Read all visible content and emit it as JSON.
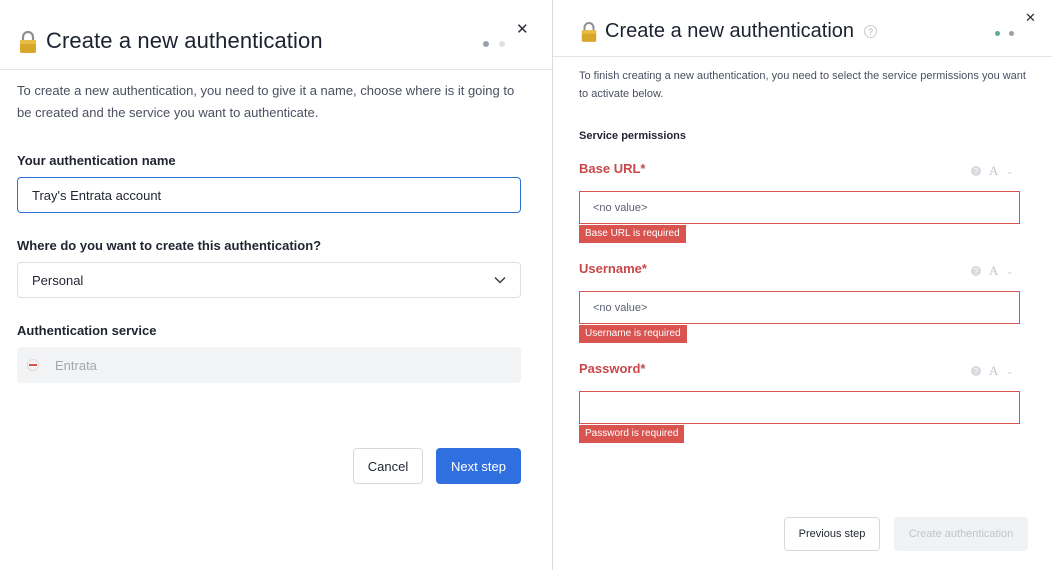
{
  "left": {
    "title": "Create a new authentication",
    "intro": "To create a new authentication, you need to give it a name, choose where is it going to be created and the service you want to authenticate.",
    "name_label": "Your authentication name",
    "name_value": "Tray's Entrata account",
    "location_label": "Where do you want to create this authentication?",
    "location_value": "Personal",
    "service_label": "Authentication service",
    "service_value": "Entrata",
    "cancel_label": "Cancel",
    "next_label": "Next step",
    "step_dots": {
      "active": "#9aa0aa",
      "inactive": "#dde0e5"
    }
  },
  "right": {
    "title": "Create a new authentication",
    "intro": "To finish creating a new authentication, you need to select the service permissions you want to activate below.",
    "permissions_heading": "Service permissions",
    "fields": [
      {
        "label": "Base URL*",
        "placeholder": "<no value>",
        "error": "Base URL is required"
      },
      {
        "label": "Username*",
        "placeholder": "<no value>",
        "error": "Username is required"
      },
      {
        "label": "Password*",
        "placeholder": "",
        "error": "Password is required"
      }
    ],
    "prev_label": "Previous step",
    "create_label": "Create authentication",
    "step_dots": {
      "done": "#5fae8a",
      "active": "#9aa0aa"
    }
  },
  "icons": {
    "close": "close-icon",
    "lock": "lock-icon",
    "help": "help-icon",
    "chevron": "chevron-down-icon",
    "service": "entrata-logo-icon"
  },
  "colors": {
    "primary": "#2f6fdf",
    "error": "#d9534f",
    "accent_gold": "#c9a227"
  }
}
